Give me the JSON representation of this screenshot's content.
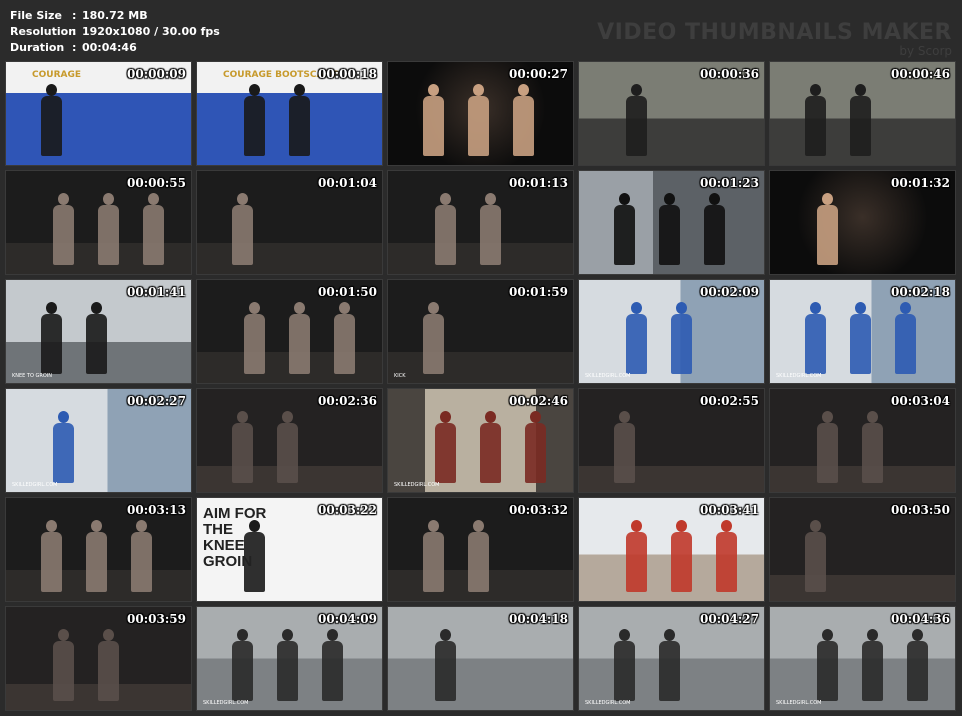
{
  "info": {
    "file_size_label": "File Size",
    "file_size": "180.72 MB",
    "resolution_label": "Resolution",
    "resolution": "1920x1080 / 30.00 fps",
    "duration_label": "Duration",
    "duration": "00:04:46"
  },
  "brand": {
    "title": "VIDEO THUMBNAILS MAKER",
    "subtitle": "by Scorp"
  },
  "frames": [
    {
      "time": "00:00:09",
      "scene": "studio-blue",
      "text": "COURAGE"
    },
    {
      "time": "00:00:18",
      "scene": "studio-blue",
      "text": "COURAGE  BOOTSCAMP"
    },
    {
      "time": "00:00:27",
      "scene": "dark-portrait",
      "text": ""
    },
    {
      "time": "00:00:36",
      "scene": "gym-grey",
      "text": ""
    },
    {
      "time": "00:00:46",
      "scene": "gym-grey",
      "text": ""
    },
    {
      "time": "00:00:55",
      "scene": "dark-studio",
      "text": ""
    },
    {
      "time": "00:01:04",
      "scene": "dark-studio",
      "text": ""
    },
    {
      "time": "00:01:13",
      "scene": "dark-studio",
      "text": ""
    },
    {
      "time": "00:01:23",
      "scene": "gym-poster",
      "text": ""
    },
    {
      "time": "00:01:32",
      "scene": "dark-portrait",
      "text": ""
    },
    {
      "time": "00:01:41",
      "scene": "outdoor-wall",
      "text": "KNEE TO GROIN"
    },
    {
      "time": "00:01:50",
      "scene": "dark-studio",
      "text": ""
    },
    {
      "time": "00:01:59",
      "scene": "dark-studio",
      "text": "KICK"
    },
    {
      "time": "00:02:09",
      "scene": "collage-blue",
      "text": "SKILLEDGIRL.COM"
    },
    {
      "time": "00:02:18",
      "scene": "collage-blue",
      "text": "SKILLEDGIRL.COM"
    },
    {
      "time": "00:02:27",
      "scene": "collage-blue",
      "text": "SKILLEDGIRL.COM"
    },
    {
      "time": "00:02:36",
      "scene": "dark-room",
      "text": ""
    },
    {
      "time": "00:02:46",
      "scene": "hallway",
      "text": "SKILLEDGIRL.COM"
    },
    {
      "time": "00:02:55",
      "scene": "dark-room",
      "text": ""
    },
    {
      "time": "00:03:04",
      "scene": "dark-room",
      "text": ""
    },
    {
      "time": "00:03:13",
      "scene": "dark-studio",
      "text": ""
    },
    {
      "time": "00:03:22",
      "scene": "white-caption",
      "text": "AIM FOR THE KNEE GROIN"
    },
    {
      "time": "00:03:32",
      "scene": "dark-studio",
      "text": ""
    },
    {
      "time": "00:03:41",
      "scene": "bright-outdoor",
      "text": ""
    },
    {
      "time": "00:03:50",
      "scene": "dark-room",
      "text": ""
    },
    {
      "time": "00:03:59",
      "scene": "dark-room",
      "text": ""
    },
    {
      "time": "00:04:09",
      "scene": "concrete",
      "text": "SKILLEDGIRL.COM"
    },
    {
      "time": "00:04:18",
      "scene": "concrete",
      "text": ""
    },
    {
      "time": "00:04:27",
      "scene": "concrete",
      "text": "SKILLEDGIRL.COM"
    },
    {
      "time": "00:04:36",
      "scene": "concrete",
      "text": "SKILLEDGIRL.COM"
    }
  ],
  "colors": {
    "background": "#2b2b2b",
    "timestamp": "#ffffff",
    "brand": "#3e3e3e",
    "studio_blue": "#2f55b6"
  }
}
